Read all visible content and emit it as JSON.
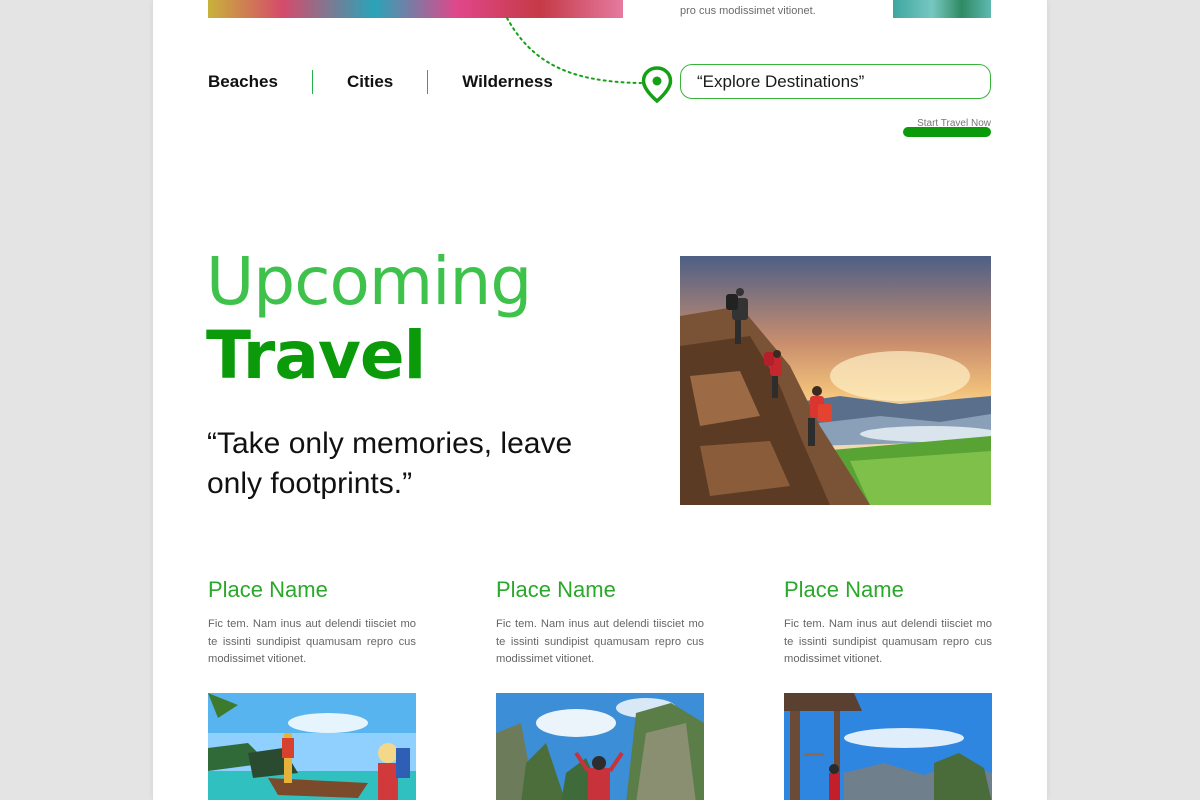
{
  "top": {
    "snippet": "pro cus modissimet vitionet."
  },
  "nav": {
    "items": [
      {
        "label": "Beaches"
      },
      {
        "label": "Cities"
      },
      {
        "label": "Wilderness"
      }
    ]
  },
  "search": {
    "value": "“Explore Destinations”"
  },
  "cta": {
    "label": "Start Travel Now"
  },
  "hero": {
    "title_line1": "Upcoming",
    "title_line2": "Travel",
    "quote": "“Take only memories, leave only footprints.”"
  },
  "places": [
    {
      "name": "Place Name",
      "description": "Fic tem. Nam inus aut delendi tiisciet mo te issinti sundipist quamusam repro cus modissimet vitionet."
    },
    {
      "name": "Place Name",
      "description": "Fic tem. Nam inus aut delendi tiisciet mo te issinti sundipist quamusam repro cus modissimet vitionet."
    },
    {
      "name": "Place Name",
      "description": "Fic tem. Nam inus aut delendi tiisciet mo te issinti sundipist quamusam repro cus modissimet vitionet."
    }
  ],
  "colors": {
    "accent_green": "#0a9a0a",
    "light_green": "#3ec24b"
  },
  "icons": {
    "location": "map-pin-icon"
  }
}
